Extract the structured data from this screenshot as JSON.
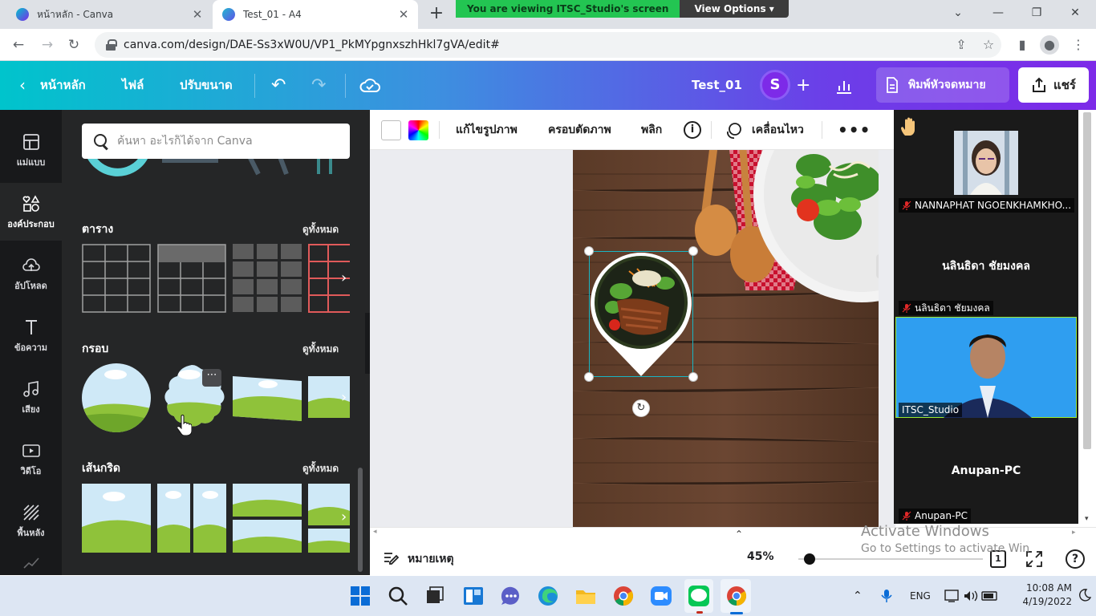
{
  "browser": {
    "tabs": [
      {
        "title": "หน้าหลัก - Canva",
        "active": false
      },
      {
        "title": "Test_01 - A4",
        "active": true
      }
    ],
    "url": "canva.com/design/DAE-Ss3xW0U/VP1_PkMYpgnxszhHkl7gVA/edit#",
    "screen_share": {
      "message": "You are viewing ITSC_Studio's screen",
      "options_label": "View Options"
    }
  },
  "header": {
    "home_label": "หน้าหลัก",
    "file_label": "ไฟล์",
    "resize_label": "ปรับขนาด",
    "doc_title": "Test_01",
    "avatar_initial": "S",
    "print_label": "พิมพ์หัวจดหมาย",
    "share_label": "แชร์"
  },
  "rail": [
    {
      "label": "แม่แบบ",
      "icon": "template-icon"
    },
    {
      "label": "องค์ประกอบ",
      "icon": "elements-icon",
      "active": true
    },
    {
      "label": "อัปโหลด",
      "icon": "upload-icon"
    },
    {
      "label": "ข้อความ",
      "icon": "text-icon"
    },
    {
      "label": "เสียง",
      "icon": "music-icon"
    },
    {
      "label": "วิดีโอ",
      "icon": "video-icon"
    },
    {
      "label": "พื้นหลัง",
      "icon": "background-icon"
    }
  ],
  "panel": {
    "search_placeholder": "ค้นหา อะไรก็ได้จาก Canva",
    "sections": [
      {
        "title": "ตาราง",
        "see_all": "ดูทั้งหมด"
      },
      {
        "title": "กรอบ",
        "see_all": "ดูทั้งหมด"
      },
      {
        "title": "เส้นกริด",
        "see_all": "ดูทั้งหมด"
      }
    ]
  },
  "toolbar": {
    "edit_image": "แก้ไขรูปภาพ",
    "crop": "ครอบตัดภาพ",
    "flip": "พลิก",
    "animate": "เคลื่อนไหว"
  },
  "bottom": {
    "notes_label": "หมายเหตุ",
    "zoom": "45%",
    "page_number": "1"
  },
  "watermark": {
    "line1": "Activate Windows",
    "line2": "Go to Settings to activate Windows."
  },
  "zoom_participants": [
    {
      "name": "NANNAPHAT NGOENKHAMKHO...",
      "has_video": true,
      "muted": true
    },
    {
      "name": "นลินธิดา ชัยมงคล",
      "display": "นลินธิดา ชัยมงคล",
      "has_video": false,
      "muted": true
    },
    {
      "name": "ITSC_Studio",
      "has_video": true,
      "muted": false,
      "speaking": true
    },
    {
      "name": "Anupan-PC",
      "display": "Anupan-PC",
      "has_video": false,
      "muted": true
    }
  ],
  "taskbar": {
    "language": "ENG",
    "time": "10:08 AM",
    "date": "4/19/2022"
  },
  "colors": {
    "canva_teal": "#00c4cc",
    "canva_purple": "#7d2ae8",
    "selection": "#19b5c3",
    "share_banner": "#23c552"
  }
}
